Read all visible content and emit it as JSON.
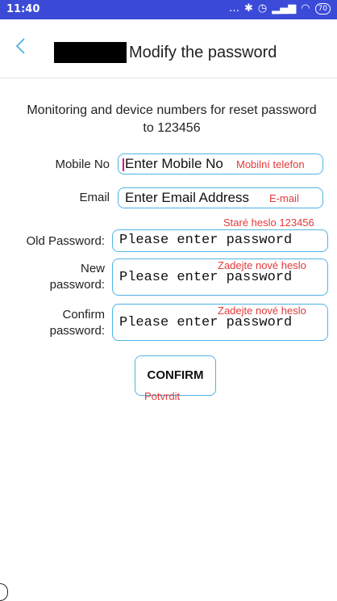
{
  "status_bar": {
    "time": "11:40",
    "icons": [
      "more-dots",
      "bluetooth",
      "alarm",
      "signal",
      "wifi"
    ],
    "battery": "70"
  },
  "app_bar": {
    "title": "Modify the password"
  },
  "description": "Monitoring and device numbers for reset password to 123456",
  "form": {
    "mobile_label": "Mobile No",
    "mobile_placeholder": "Enter Mobile No",
    "mobile_annotation": "Mobilní telefon",
    "email_label": "Email",
    "email_placeholder": "Enter Email Address",
    "email_annotation": "E-mail",
    "old_password_label": "Old Password:",
    "old_password_placeholder": "Please enter password",
    "old_password_annotation": "Staré heslo 123456",
    "new_password_label_line1": "New",
    "new_password_label_line2": "password:",
    "new_password_placeholder": "Please enter password",
    "new_password_annotation": "Zadejte nové heslo",
    "confirm_password_label_line1": "Confirm",
    "confirm_password_label_line2": "password:",
    "confirm_password_placeholder": "Please enter password",
    "confirm_password_annotation": "Zadejte nové heslo",
    "confirm_button": "CONFIRM",
    "confirm_annotation": "Potvrdit"
  },
  "colors": {
    "status_bar": "#3b4bd8",
    "field_border": "#4fb3e6",
    "annotation": "#e23a3a",
    "back_arrow": "#4fb3e6"
  }
}
